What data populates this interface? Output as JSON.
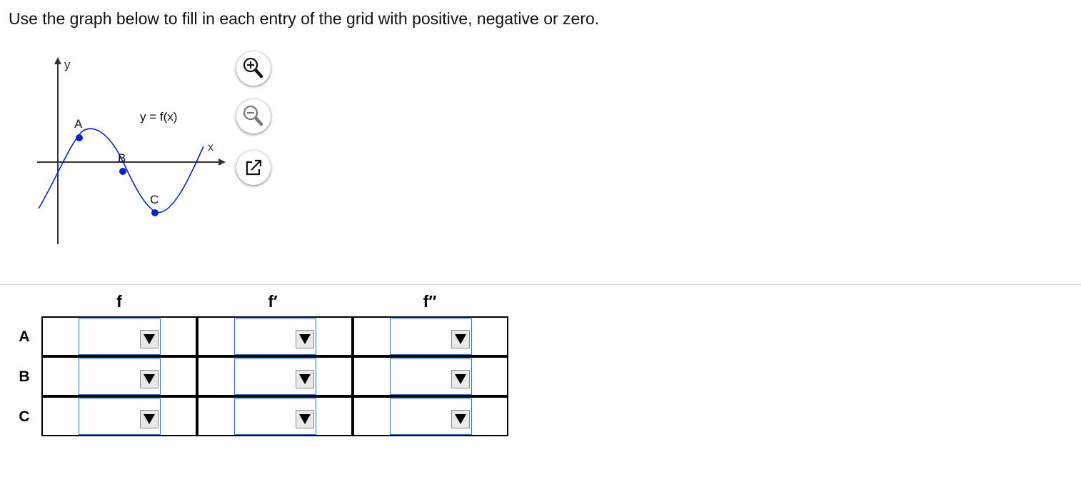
{
  "instruction": "Use the graph below to fill in each entry of the grid with positive, negative or zero.",
  "graph": {
    "y_axis_label": "y",
    "x_axis_label": "x",
    "curve_label": "y = f(x)",
    "point_labels": [
      "A",
      "B",
      "C"
    ],
    "curve_color": "#0a1fd6"
  },
  "toolbar": {
    "zoom_in_icon": "zoom-in-icon",
    "zoom_out_icon": "zoom-out-icon",
    "popout_icon": "popout-icon"
  },
  "table": {
    "columns": [
      "f",
      "f′",
      "f′′"
    ],
    "rows": [
      "A",
      "B",
      "C"
    ],
    "cells": [
      [
        "",
        "",
        ""
      ],
      [
        "",
        "",
        ""
      ],
      [
        "",
        "",
        ""
      ]
    ],
    "options": [
      "positive",
      "negative",
      "zero"
    ]
  },
  "colors": {
    "select_border": "#3a6fc9",
    "divider": "#d3d3e8"
  }
}
